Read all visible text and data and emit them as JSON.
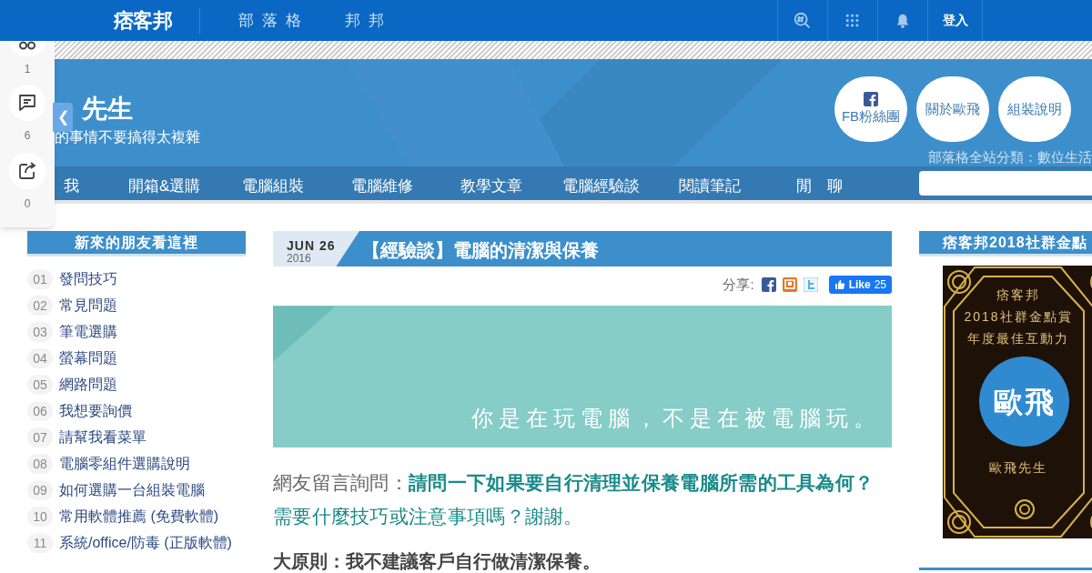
{
  "top_bar": {
    "logo": "痞客邦",
    "links": [
      "部 落 格",
      "邦 邦"
    ],
    "icons": [
      {
        "kind": "hashtag-search"
      },
      {
        "kind": "apps"
      },
      {
        "kind": "bell"
      }
    ],
    "login": "登入"
  },
  "side_panel": {
    "items": [
      {
        "kind": "link",
        "count": "1"
      },
      {
        "kind": "comment",
        "count": "6"
      },
      {
        "kind": "share",
        "count": "0"
      }
    ],
    "collapse": "❮"
  },
  "header": {
    "title": "先生",
    "subtitle": "的事情不要搞得太複雜",
    "circle_links": [
      {
        "kind": "facebook",
        "label": "FB粉絲團"
      },
      {
        "kind": "plain",
        "label": "關於歐飛"
      },
      {
        "kind": "plain",
        "label": "組裝說明"
      }
    ],
    "category": "部落格全站分類：數位生活"
  },
  "nav": {
    "items": [
      "我",
      "開箱&選購",
      "電腦組裝",
      "電腦維修",
      "教學文章",
      "電腦經驗談",
      "閱讀筆記",
      "閒　聊"
    ]
  },
  "left_sidebar": {
    "title": "新來的朋友看這裡",
    "items": [
      {
        "number": "01",
        "label": "發問技巧"
      },
      {
        "number": "02",
        "label": "常見問題"
      },
      {
        "number": "03",
        "label": "筆電選購"
      },
      {
        "number": "04",
        "label": "螢幕問題"
      },
      {
        "number": "05",
        "label": "網路問題"
      },
      {
        "number": "06",
        "label": "我想要詢價"
      },
      {
        "number": "07",
        "label": "請幫我看菜單"
      },
      {
        "number": "08",
        "label": "電腦零組件選購說明"
      },
      {
        "number": "09",
        "label": "如何選購一台組裝電腦"
      },
      {
        "number": "10",
        "label": "常用軟體推薦 (免費軟體)"
      },
      {
        "number": "11",
        "label": "系統/office/防毒 (正版軟體)"
      }
    ]
  },
  "post": {
    "date": "JUN 26",
    "year": "2016",
    "title": "【經驗談】電腦的清潔與保養",
    "share_label": "分享:",
    "share_icons": [
      {
        "kind": "facebook"
      },
      {
        "kind": "plurk"
      },
      {
        "kind": "twitter"
      }
    ],
    "like": {
      "label": "Like",
      "count": "25"
    },
    "banner_text": "你是在玩電腦，不是在被電腦玩。",
    "question_prefix": "網友留言詢問：",
    "question": "**請問一下如果要自行清理並保養電腦所需的工具為何？**需要什麼技巧或注意事項嗎？謝謝。",
    "principle": "大原則：我不建議客戶自行做清潔保養。"
  },
  "right_sidebar": {
    "title": "痞客邦2018社群金點",
    "award": {
      "lines": [
        "痞客邦",
        "2018社群金點賞",
        "年度最佳互動力"
      ],
      "name": "歐飛",
      "caption": "歐飛先生"
    }
  }
}
